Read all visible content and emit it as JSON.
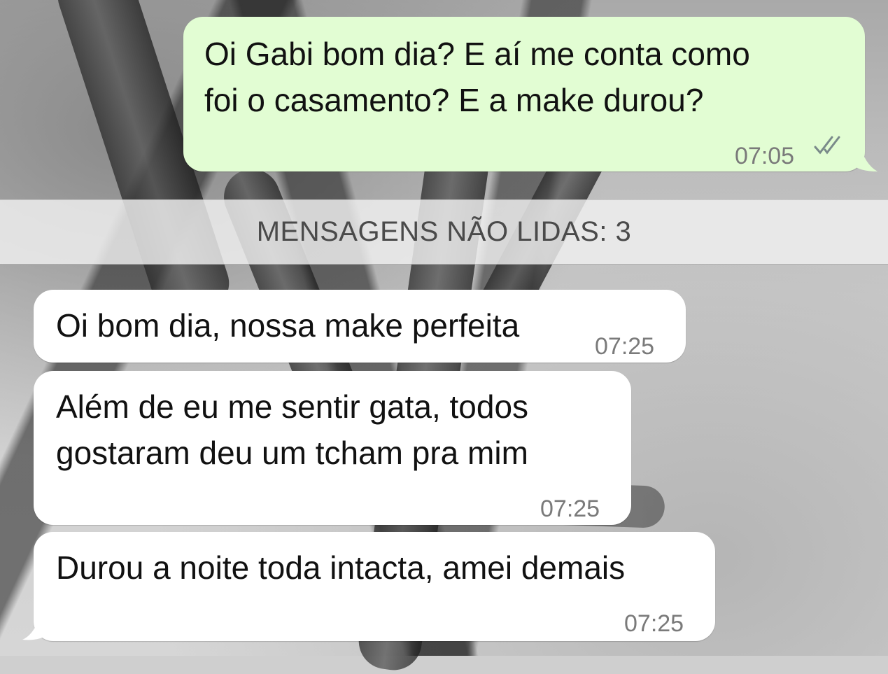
{
  "messages": [
    {
      "direction": "outgoing",
      "text_line1": "Oi Gabi bom dia? E aí me conta como",
      "text_line2": "foi o casamento? E a make durou?",
      "time": "07:05",
      "status": "read"
    },
    {
      "direction": "incoming",
      "text": "Oi bom dia, nossa make perfeita",
      "time": "07:25"
    },
    {
      "direction": "incoming",
      "text_line1": "Além de eu me sentir gata, todos",
      "text_line2": "gostaram deu um tcham pra mim",
      "time": "07:25"
    },
    {
      "direction": "incoming",
      "text": "Durou a noite toda intacta, amei demais",
      "time": "07:25"
    }
  ],
  "unread_divider": "MENSAGENS NÃO LIDAS: 3",
  "icons": {
    "read_receipt": "double-check-icon"
  },
  "colors": {
    "outgoing_bubble": "#e2fdd3",
    "incoming_bubble": "#ffffff",
    "read_ticks": "#7a8a8a"
  }
}
